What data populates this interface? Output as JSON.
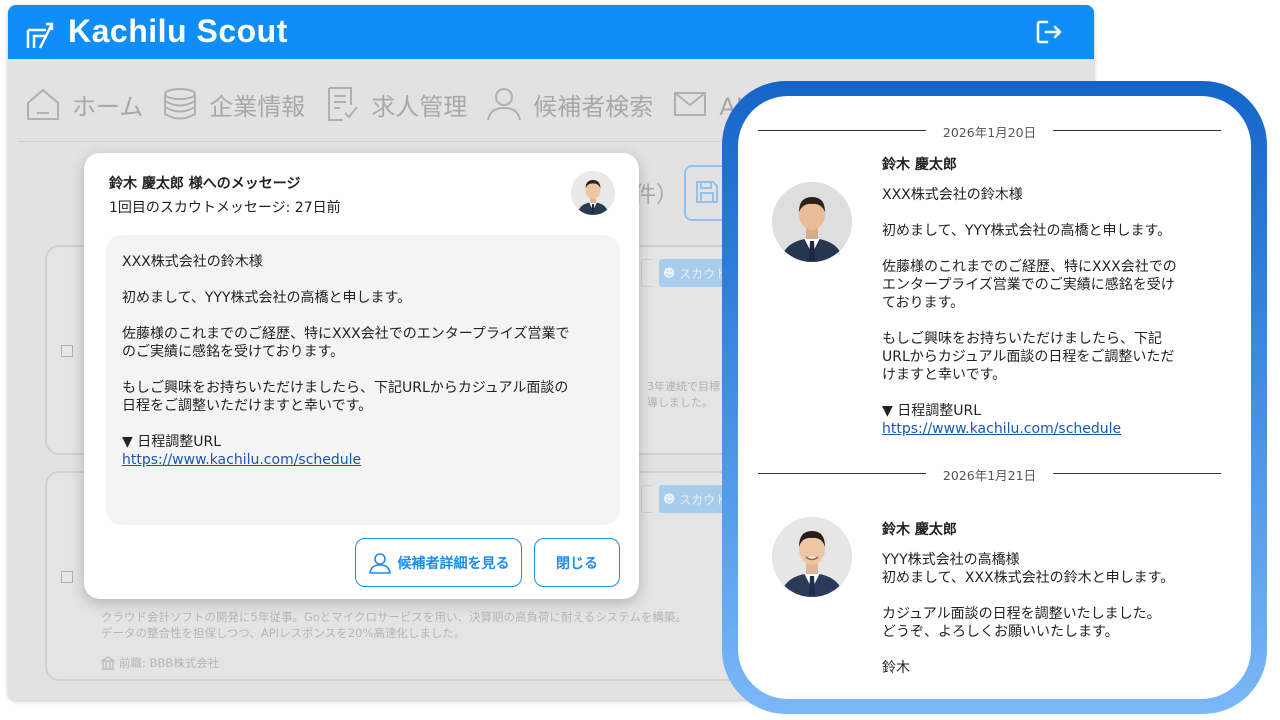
{
  "app": {
    "title": "Kachilu Scout",
    "brand_color": "#108ef7",
    "nav": [
      {
        "label": "ホーム",
        "icon": "home-icon"
      },
      {
        "label": "企業情報",
        "icon": "database-icon"
      },
      {
        "label": "求人管理",
        "icon": "document-check-icon"
      },
      {
        "label": "候補者検索",
        "icon": "person-icon"
      },
      {
        "label": "AIス",
        "icon": "mail-icon"
      }
    ],
    "count_fragment": "件）",
    "cards": [
      {
        "scout_label": "スカウト",
        "side_note_1": "3年連続で目標",
        "side_note_2": "導しました。"
      },
      {
        "scout_label": "スカウト",
        "experience_1": "クラウド会計ソフトの開発に5年従事。Goとマイクロサービスを用い、決算期の高負荷に耐えるシステムを構築。",
        "experience_2": "データの整合性を担保しつつ、APIレスポンスを20%高速化しました。",
        "previous_company": "前職: BBB株式会社"
      }
    ]
  },
  "modal": {
    "title": "鈴木 慶太郎 様へのメッセージ",
    "subtitle": "1回目のスカウトメッセージ: 27日前",
    "message": {
      "greeting": "XXX株式会社の鈴木様",
      "intro": "初めまして、YYY株式会社の高橋と申します。",
      "body1_line1": "佐藤様のこれまでのご経歴、特にXXX会社でのエンタープライズ営業で",
      "body1_line2": "のご実績に感銘を受けております。",
      "body2_line1": "もしご興味をお持ちいただけましたら、下記URLからカジュアル面談の",
      "body2_line2": "日程をご調整いただけますと幸いです。",
      "url_label": "▼ 日程調整URL",
      "url": "https://www.kachilu.com/schedule"
    },
    "detail_button": "候補者詳細を見る",
    "close_button": "閉じる"
  },
  "chat": {
    "frame_gradient": [
      "#1565c9",
      "#7ab8f8"
    ],
    "messages": [
      {
        "date": "2026年1月20日",
        "sender": "鈴木 慶太郎",
        "greeting": "XXX株式会社の鈴木様",
        "intro": "初めまして、YYY株式会社の高橋と申します。",
        "body1_l1": "佐藤様のこれまでのご経歴、特にXXX会社での",
        "body1_l2": "エンタープライズ営業でのご実績に感銘を受け",
        "body1_l3": "ております。",
        "body2_l1": "もしご興味をお持ちいただけましたら、下記",
        "body2_l2": "URLからカジュアル面談の日程をご調整いただ",
        "body2_l3": "けますと幸いです。",
        "url_label": "▼ 日程調整URL",
        "url": "https://www.kachilu.com/schedule"
      },
      {
        "date": "2026年1月21日",
        "sender": "鈴木 慶太郎",
        "line1": "YYY株式会社の高橋様",
        "line2": "初めまして、XXX株式会社の鈴木と申します。",
        "line3": "カジュアル面談の日程を調整いたしました。",
        "line4": "どうぞ、よろしくお願いいたします。",
        "signature": "鈴木"
      }
    ]
  }
}
